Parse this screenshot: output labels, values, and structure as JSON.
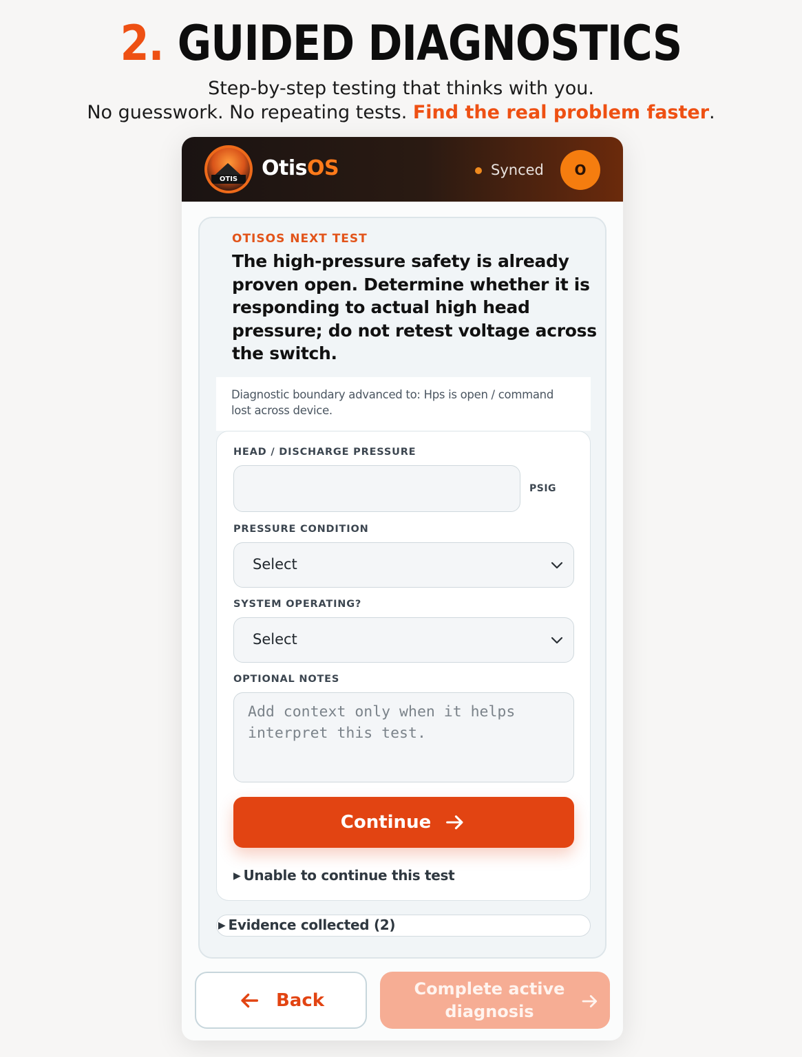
{
  "hero": {
    "number": "2.",
    "title": "GUIDED DIAGNOSTICS",
    "subtitle_line1": "Step-by-step testing that thinks with you.",
    "subtitle_line2_plain": "No guesswork. No repeating tests. ",
    "subtitle_line2_accent": "Find the real problem faster",
    "subtitle_line2_end": "."
  },
  "appbar": {
    "logo_text": "OTIS",
    "brand_main": "Otis",
    "brand_accent": "OS",
    "sync_status": "Synced",
    "avatar_initial": "O",
    "accent_color": "#f57d0f"
  },
  "test": {
    "eyebrow": "OTISOS NEXT TEST",
    "instruction": "The high-pressure safety is already proven open. Determine whether it is responding to actual high head pressure; do not retest voltage across the switch.",
    "boundary": "Diagnostic boundary advanced to: Hps is open / command lost across device."
  },
  "form": {
    "head_pressure_label": "HEAD / DISCHARGE PRESSURE",
    "head_pressure_value": "",
    "head_pressure_unit": "PSIG",
    "pressure_condition_label": "PRESSURE CONDITION",
    "pressure_condition_value": "Select",
    "system_operating_label": "SYSTEM OPERATING?",
    "system_operating_value": "Select",
    "notes_label": "OPTIONAL NOTES",
    "notes_placeholder": "Add context only when it helps interpret this test.",
    "continue_label": "Continue",
    "unable_label": "Unable to continue this test",
    "evidence_label": "Evidence collected (2)"
  },
  "footer": {
    "back_label": "Back",
    "complete_label": "Complete active diagnosis"
  },
  "colors": {
    "primary": "#e24412",
    "primary_disabled": "#f6ad94",
    "dark_header": "#1a1312"
  }
}
